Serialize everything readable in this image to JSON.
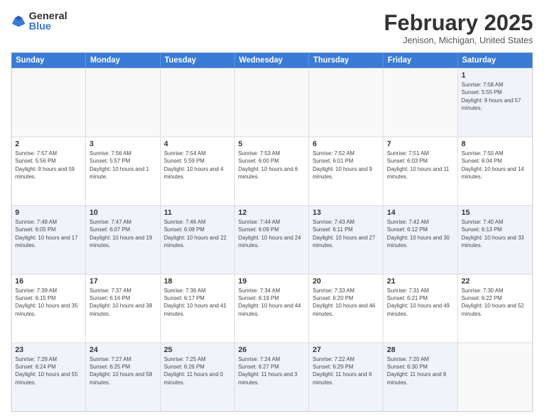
{
  "logo": {
    "general": "General",
    "blue": "Blue"
  },
  "header": {
    "month": "February 2025",
    "location": "Jenison, Michigan, United States"
  },
  "weekdays": [
    "Sunday",
    "Monday",
    "Tuesday",
    "Wednesday",
    "Thursday",
    "Friday",
    "Saturday"
  ],
  "rows": [
    [
      {
        "day": "",
        "info": ""
      },
      {
        "day": "",
        "info": ""
      },
      {
        "day": "",
        "info": ""
      },
      {
        "day": "",
        "info": ""
      },
      {
        "day": "",
        "info": ""
      },
      {
        "day": "",
        "info": ""
      },
      {
        "day": "1",
        "info": "Sunrise: 7:58 AM\nSunset: 5:55 PM\nDaylight: 9 hours and 57 minutes."
      }
    ],
    [
      {
        "day": "2",
        "info": "Sunrise: 7:57 AM\nSunset: 5:56 PM\nDaylight: 9 hours and 59 minutes."
      },
      {
        "day": "3",
        "info": "Sunrise: 7:56 AM\nSunset: 5:57 PM\nDaylight: 10 hours and 1 minute."
      },
      {
        "day": "4",
        "info": "Sunrise: 7:54 AM\nSunset: 5:59 PM\nDaylight: 10 hours and 4 minutes."
      },
      {
        "day": "5",
        "info": "Sunrise: 7:53 AM\nSunset: 6:00 PM\nDaylight: 10 hours and 6 minutes."
      },
      {
        "day": "6",
        "info": "Sunrise: 7:52 AM\nSunset: 6:01 PM\nDaylight: 10 hours and 9 minutes."
      },
      {
        "day": "7",
        "info": "Sunrise: 7:51 AM\nSunset: 6:03 PM\nDaylight: 10 hours and 11 minutes."
      },
      {
        "day": "8",
        "info": "Sunrise: 7:50 AM\nSunset: 6:04 PM\nDaylight: 10 hours and 14 minutes."
      }
    ],
    [
      {
        "day": "9",
        "info": "Sunrise: 7:48 AM\nSunset: 6:05 PM\nDaylight: 10 hours and 17 minutes."
      },
      {
        "day": "10",
        "info": "Sunrise: 7:47 AM\nSunset: 6:07 PM\nDaylight: 10 hours and 19 minutes."
      },
      {
        "day": "11",
        "info": "Sunrise: 7:46 AM\nSunset: 6:08 PM\nDaylight: 10 hours and 22 minutes."
      },
      {
        "day": "12",
        "info": "Sunrise: 7:44 AM\nSunset: 6:09 PM\nDaylight: 10 hours and 24 minutes."
      },
      {
        "day": "13",
        "info": "Sunrise: 7:43 AM\nSunset: 6:11 PM\nDaylight: 10 hours and 27 minutes."
      },
      {
        "day": "14",
        "info": "Sunrise: 7:42 AM\nSunset: 6:12 PM\nDaylight: 10 hours and 30 minutes."
      },
      {
        "day": "15",
        "info": "Sunrise: 7:40 AM\nSunset: 6:13 PM\nDaylight: 10 hours and 33 minutes."
      }
    ],
    [
      {
        "day": "16",
        "info": "Sunrise: 7:39 AM\nSunset: 6:15 PM\nDaylight: 10 hours and 35 minutes."
      },
      {
        "day": "17",
        "info": "Sunrise: 7:37 AM\nSunset: 6:16 PM\nDaylight: 10 hours and 38 minutes."
      },
      {
        "day": "18",
        "info": "Sunrise: 7:36 AM\nSunset: 6:17 PM\nDaylight: 10 hours and 41 minutes."
      },
      {
        "day": "19",
        "info": "Sunrise: 7:34 AM\nSunset: 6:19 PM\nDaylight: 10 hours and 44 minutes."
      },
      {
        "day": "20",
        "info": "Sunrise: 7:33 AM\nSunset: 6:20 PM\nDaylight: 10 hours and 46 minutes."
      },
      {
        "day": "21",
        "info": "Sunrise: 7:31 AM\nSunset: 6:21 PM\nDaylight: 10 hours and 49 minutes."
      },
      {
        "day": "22",
        "info": "Sunrise: 7:30 AM\nSunset: 6:22 PM\nDaylight: 10 hours and 52 minutes."
      }
    ],
    [
      {
        "day": "23",
        "info": "Sunrise: 7:28 AM\nSunset: 6:24 PM\nDaylight: 10 hours and 55 minutes."
      },
      {
        "day": "24",
        "info": "Sunrise: 7:27 AM\nSunset: 6:25 PM\nDaylight: 10 hours and 58 minutes."
      },
      {
        "day": "25",
        "info": "Sunrise: 7:25 AM\nSunset: 6:26 PM\nDaylight: 11 hours and 0 minutes."
      },
      {
        "day": "26",
        "info": "Sunrise: 7:24 AM\nSunset: 6:27 PM\nDaylight: 11 hours and 3 minutes."
      },
      {
        "day": "27",
        "info": "Sunrise: 7:22 AM\nSunset: 6:29 PM\nDaylight: 11 hours and 6 minutes."
      },
      {
        "day": "28",
        "info": "Sunrise: 7:20 AM\nSunset: 6:30 PM\nDaylight: 11 hours and 9 minutes."
      },
      {
        "day": "",
        "info": ""
      }
    ]
  ]
}
